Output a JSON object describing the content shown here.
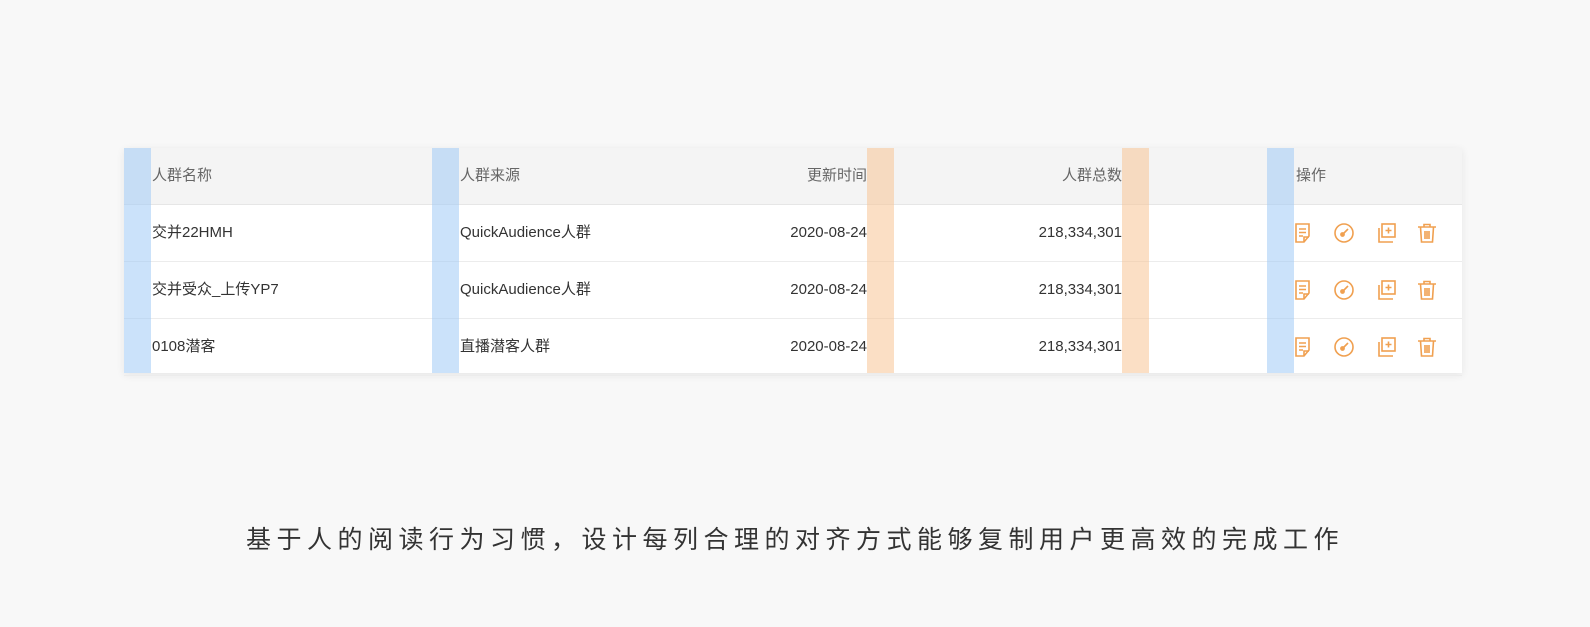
{
  "table": {
    "headers": [
      "人群名称",
      "人群来源",
      "更新时间",
      "人群总数",
      "操作"
    ],
    "rows": [
      {
        "name": "交并22HMH",
        "source": "QuickAudience人群",
        "updated": "2020-08-24",
        "count": "218,334,301"
      },
      {
        "name": "交并受众_上传YP7",
        "source": "QuickAudience人群",
        "updated": "2020-08-24",
        "count": "218,334,301"
      },
      {
        "name": "0108潜客",
        "source": "直播潜客人群",
        "updated": "2020-08-24",
        "count": "218,334,301"
      }
    ],
    "actions": [
      "edit-icon",
      "dashboard-icon",
      "copy-add-icon",
      "trash-icon"
    ]
  },
  "colors": {
    "accent": "#f0a050",
    "guide_blue": "#cce3fa",
    "guide_orange": "#fbdcc2"
  },
  "caption": "基于人的阅读行为习惯，设计每列合理的对齐方式能够复制用户更高效的完成工作"
}
